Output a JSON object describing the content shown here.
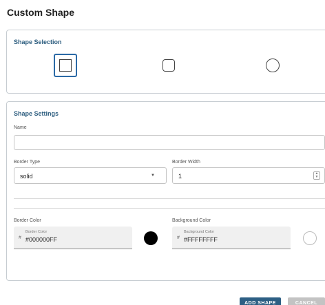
{
  "dialog": {
    "title": "Custom Shape"
  },
  "shape_selection": {
    "heading": "Shape Selection",
    "options": [
      {
        "icon": "square-icon",
        "selected": true
      },
      {
        "icon": "rounded-square-icon",
        "selected": false
      },
      {
        "icon": "circle-icon",
        "selected": false
      }
    ]
  },
  "shape_settings": {
    "heading": "Shape Settings",
    "name_label": "Name",
    "name_value": "",
    "border_type_label": "Border Type",
    "border_type_value": "solid",
    "border_width_label": "Border Width",
    "border_width_value": "1",
    "border_color_label": "Border Color",
    "border_color_field_label": "Border Color",
    "border_color_value": "#000000FF",
    "border_color_hex": "#000000",
    "background_color_label": "Background Color",
    "background_color_field_label": "Background Color",
    "background_color_value": "#FFFFFFFF",
    "background_color_hex": "#ffffff"
  },
  "actions": {
    "add_label": "ADD SHAPE",
    "cancel_label": "CANCEL"
  }
}
